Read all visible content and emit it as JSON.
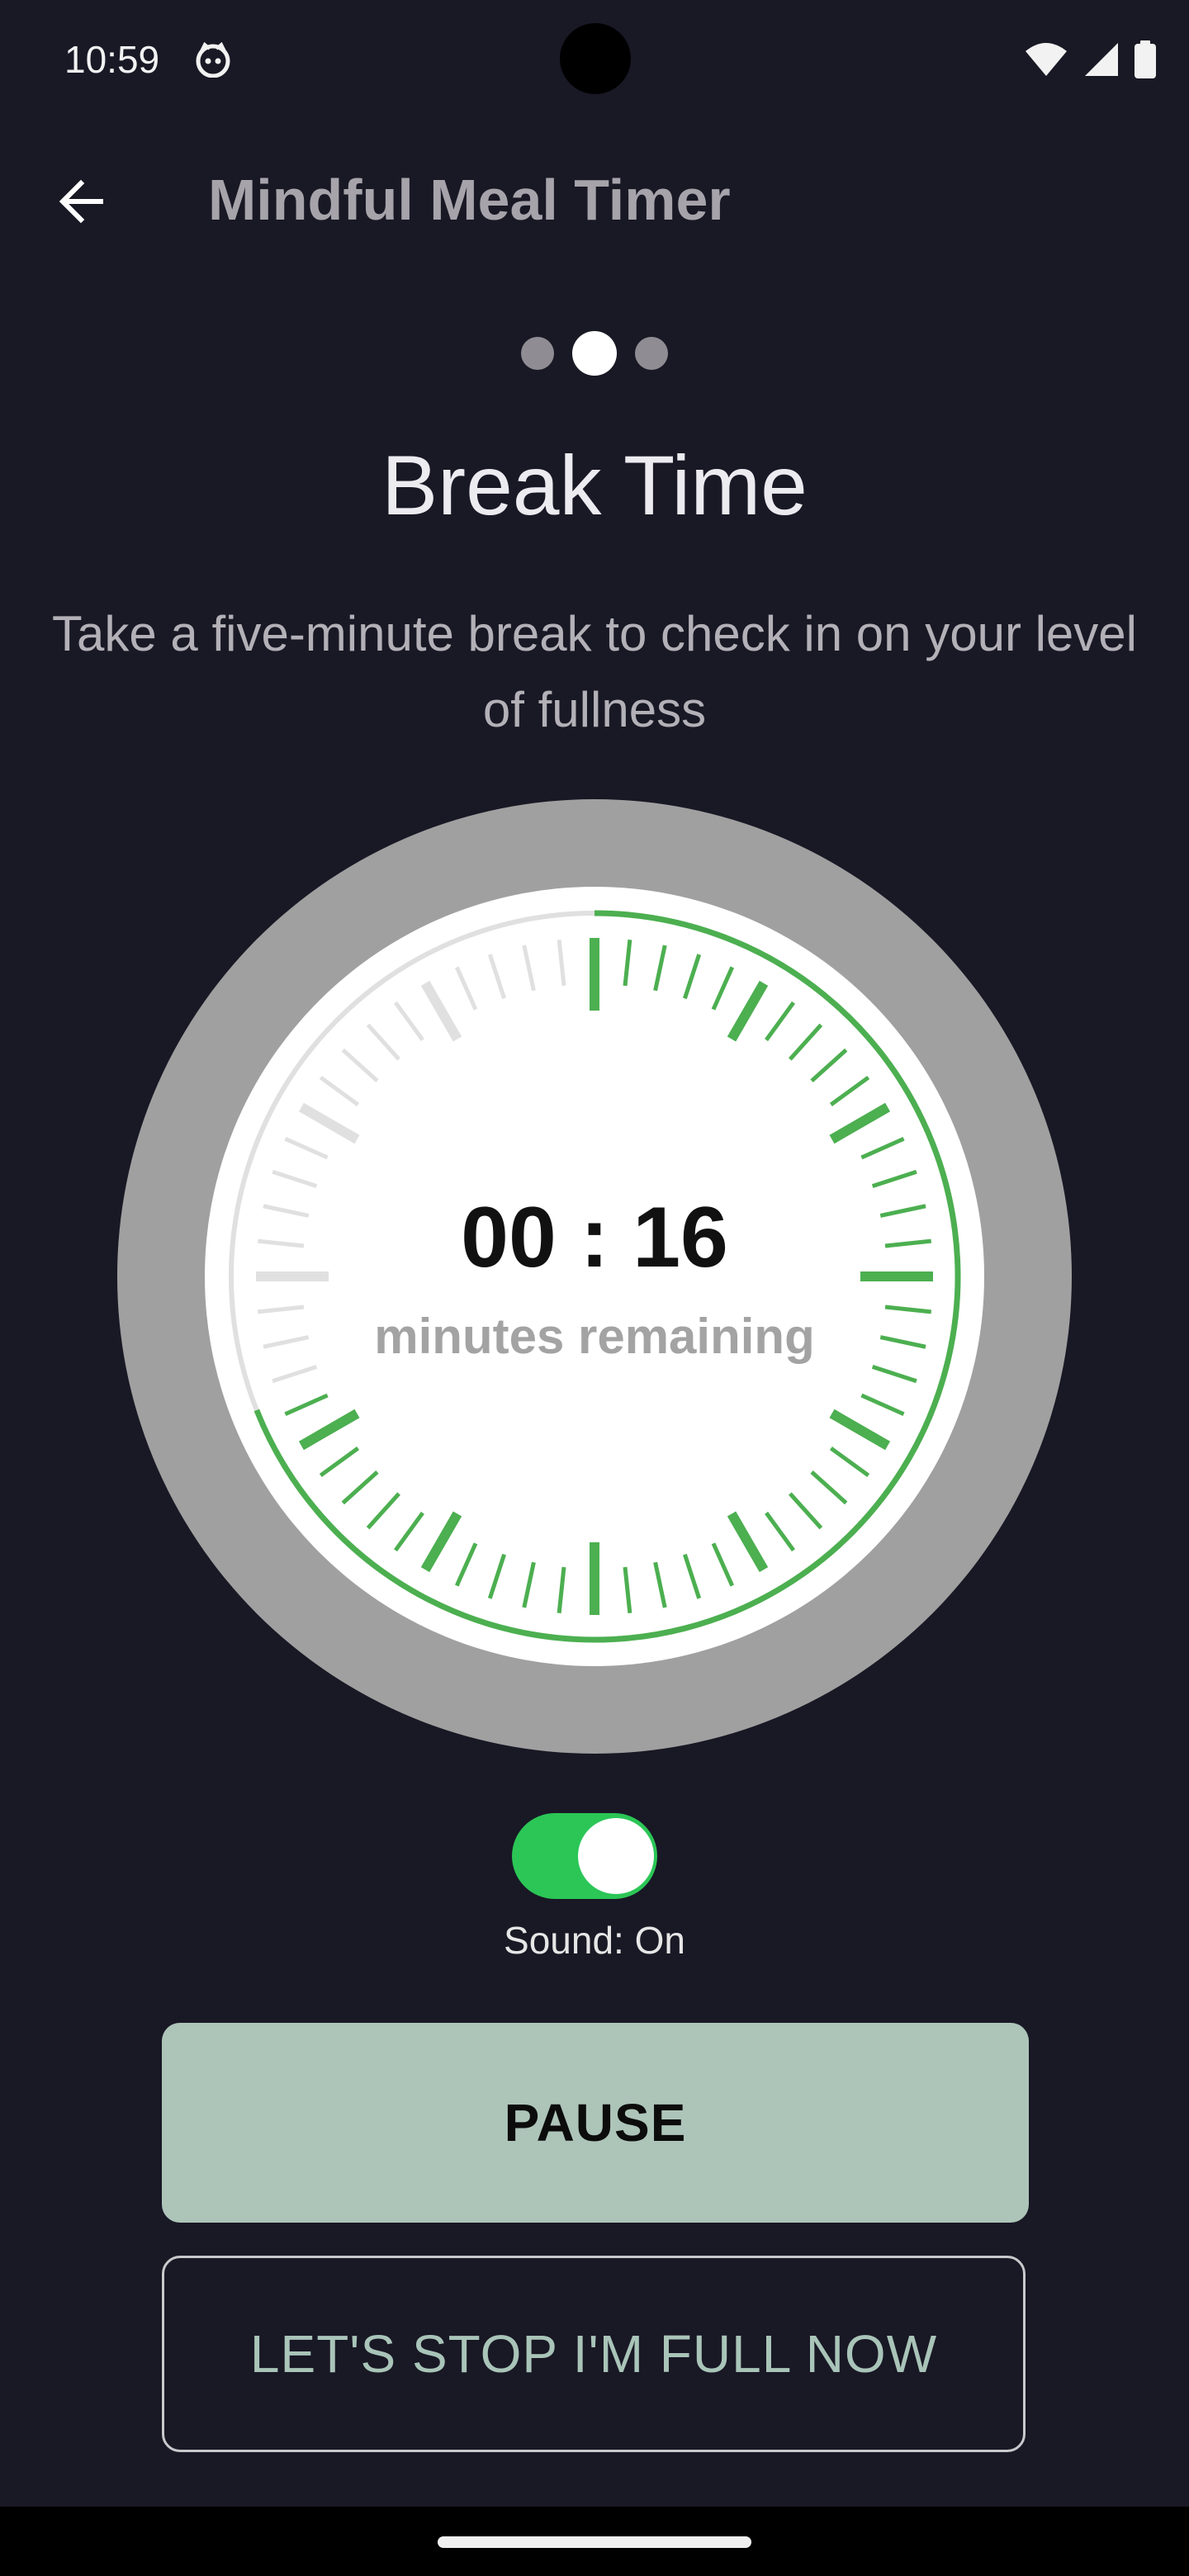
{
  "status_bar": {
    "time": "10:59",
    "icons": [
      "face-notification-icon",
      "wifi-icon",
      "cellular-signal-icon",
      "battery-icon"
    ]
  },
  "app_bar": {
    "back_icon": "arrow-back-icon",
    "title": "Mindful Meal Timer"
  },
  "pager": {
    "pages": 3,
    "active_index": 1
  },
  "heading": "Break Time",
  "description": "Take a five-minute break to check in on your level\nof fullness",
  "timer": {
    "time": "00 : 16",
    "label": "minutes remaining",
    "remaining_fraction": 0.69,
    "progress_color": "#4caf50",
    "track_color": "#e0e0e0"
  },
  "sound_toggle": {
    "on": true,
    "label": "Sound: On",
    "color": "#2bc656"
  },
  "buttons": {
    "pause": "PAUSE",
    "stop": "LET'S STOP I'M FULL NOW"
  }
}
